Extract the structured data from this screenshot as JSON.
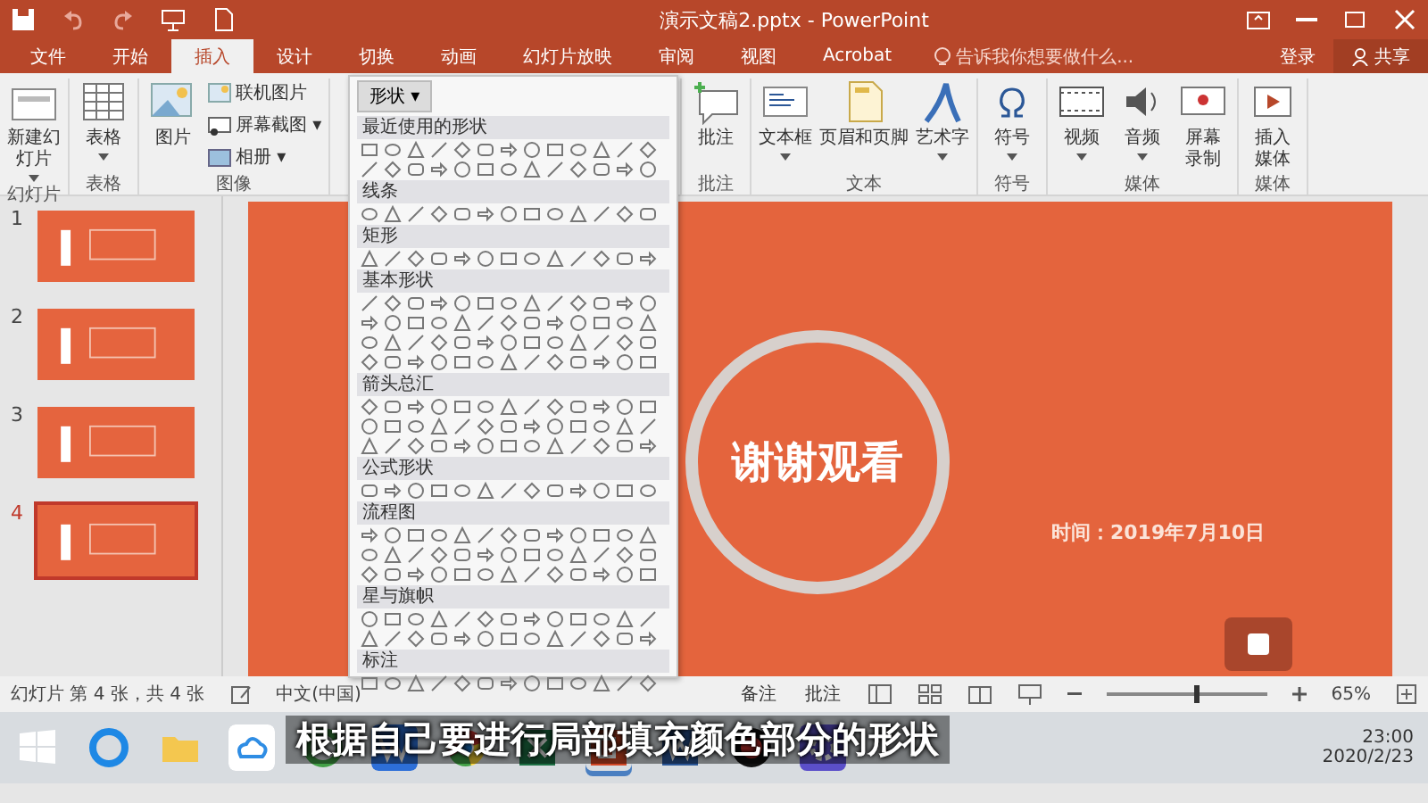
{
  "window": {
    "title": "演示文稿2.pptx - PowerPoint"
  },
  "tabs": [
    {
      "label": "文件",
      "selected": false
    },
    {
      "label": "开始",
      "selected": false
    },
    {
      "label": "插入",
      "selected": true
    },
    {
      "label": "设计",
      "selected": false
    },
    {
      "label": "切换",
      "selected": false
    },
    {
      "label": "动画",
      "selected": false
    },
    {
      "label": "幻灯片放映",
      "selected": false
    },
    {
      "label": "审阅",
      "selected": false
    },
    {
      "label": "视图",
      "selected": false
    },
    {
      "label": "Acrobat",
      "selected": false
    }
  ],
  "tell_me": {
    "placeholder": "告诉我你想要做什么..."
  },
  "account": {
    "sign_in": "登录",
    "share": "共享"
  },
  "ribbon_groups": [
    {
      "label": "幻灯片",
      "items": [
        {
          "kind": "tall",
          "label": "新建幻灯片",
          "caret": true
        }
      ]
    },
    {
      "label": "表格",
      "items": [
        {
          "kind": "big",
          "label": "表格",
          "caret": true
        }
      ]
    },
    {
      "label": "图像",
      "items": [
        {
          "kind": "big",
          "label": "图片",
          "caret": false
        },
        {
          "kind": "small",
          "label": "联机图片"
        },
        {
          "kind": "small",
          "label": "屏幕截图 ▾"
        },
        {
          "kind": "small",
          "label": "相册 ▾"
        }
      ]
    },
    {
      "items": [
        {
          "kind": "spacer"
        }
      ]
    },
    {
      "label": "批注",
      "items": [
        {
          "kind": "big",
          "label": "批注",
          "caret": false
        }
      ]
    },
    {
      "label": "文本",
      "items": [
        {
          "kind": "big",
          "label": "文本框",
          "caret": true
        },
        {
          "kind": "big",
          "label": "页眉和页脚",
          "caret": false
        },
        {
          "kind": "big",
          "label": "艺术字",
          "caret": true
        }
      ]
    },
    {
      "label": "符号",
      "items": [
        {
          "kind": "big",
          "label": "符号",
          "caret": true
        }
      ]
    },
    {
      "label": "媒体",
      "items": [
        {
          "kind": "big",
          "label": "视频",
          "caret": true
        },
        {
          "kind": "big",
          "label": "音频",
          "caret": true
        },
        {
          "kind": "tall",
          "label": "屏幕录制",
          "caret": false
        }
      ]
    },
    {
      "label": "媒体",
      "items": [
        {
          "kind": "tall",
          "label": "插入媒体",
          "caret": false
        }
      ]
    }
  ],
  "shapes_menu": {
    "button": "形状 ▾",
    "sections": [
      {
        "title": "最近使用的形状"
      },
      {
        "title": "线条"
      },
      {
        "title": "矩形"
      },
      {
        "title": "基本形状"
      },
      {
        "title": "箭头总汇"
      },
      {
        "title": "公式形状"
      },
      {
        "title": "流程图"
      },
      {
        "title": "星与旗帜"
      },
      {
        "title": "标注"
      }
    ]
  },
  "slides": [
    {
      "number": "1",
      "selected": false
    },
    {
      "number": "2",
      "selected": false
    },
    {
      "number": "3",
      "selected": false
    },
    {
      "number": "4",
      "selected": true
    }
  ],
  "slide": {
    "title": "谢谢观看",
    "date": "时间：2019年7月10日"
  },
  "caption": "根据自己要进行局部填充颜色部分的形状",
  "status_bar": {
    "slide_info": "幻灯片 第 4 张，共 4 张",
    "language": "中文(中国)",
    "notes": "备注",
    "comments": "批注",
    "zoom": "65%",
    "level": 0.55
  },
  "taskbar": {
    "time": "23:00",
    "date": "2020/2/23"
  }
}
